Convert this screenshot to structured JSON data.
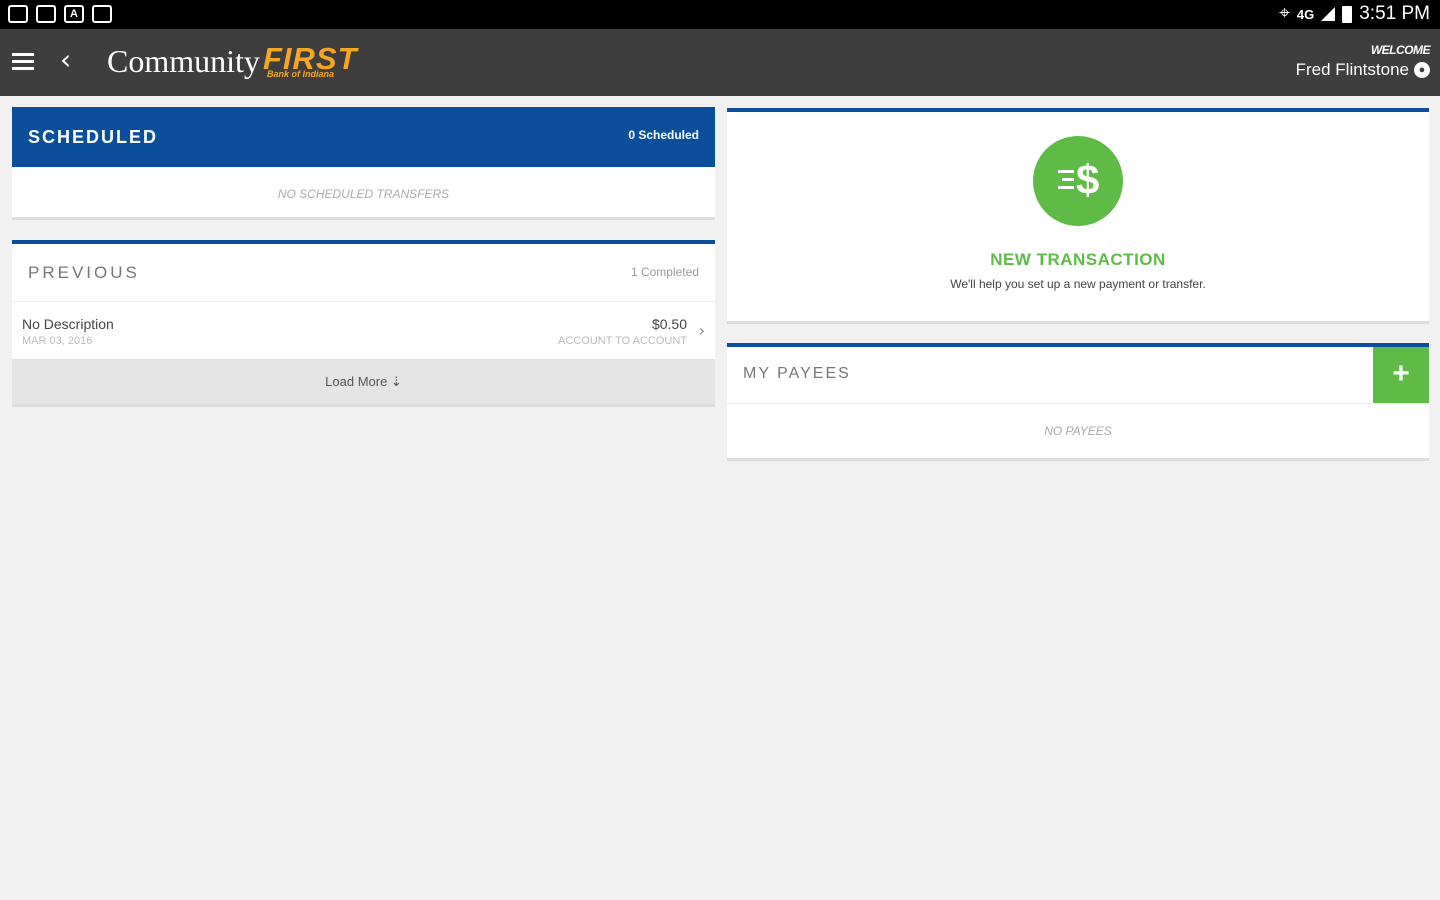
{
  "status_bar": {
    "time": "3:51 PM",
    "network": "4G",
    "left_icons": [
      "image-icon",
      "wifi-call-icon",
      "font-icon",
      "chat-icon"
    ]
  },
  "app_bar": {
    "logo_community": "Community",
    "logo_first": "FIRST",
    "logo_sub": "Bank of Indiana",
    "welcome_label": "WELCOME",
    "user_name": "Fred Flintstone"
  },
  "scheduled": {
    "title": "SCHEDULED",
    "count": "0 Scheduled",
    "empty_message": "NO SCHEDULED TRANSFERS"
  },
  "previous": {
    "title": "PREVIOUS",
    "count": "1 Completed",
    "transactions": [
      {
        "description": "No Description",
        "date": "MAR 03, 2016",
        "amount": "$0.50",
        "type": "ACCOUNT TO ACCOUNT"
      }
    ],
    "load_more": "Load More ⇣"
  },
  "new_transaction": {
    "title": "NEW TRANSACTION",
    "subtitle": "We'll help you set up a new payment or transfer."
  },
  "payees": {
    "title": "MY PAYEES",
    "add_label": "+",
    "empty_message": "NO PAYEES"
  },
  "colors": {
    "brand_blue": "#0b4f9c",
    "accent_green": "#5dbb46",
    "logo_orange": "#f5a623",
    "app_bar": "#3e3e3e"
  }
}
